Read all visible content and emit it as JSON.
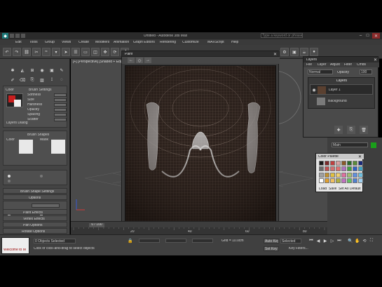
{
  "title_bar": {
    "app_title": "Untitled - Autodesk 3ds Max",
    "search_placeholder": "Type a keyword or phrase"
  },
  "menu": [
    "Edit",
    "Tools",
    "Group",
    "Views",
    "Create",
    "Modifiers",
    "Animation",
    "Graph Editors",
    "Rendering",
    "Customize",
    "MAXScript",
    "Help"
  ],
  "command_panel": {
    "section_color": "Color",
    "section_brush_settings": "Brush Settings",
    "spinners": [
      "Softness",
      "Size",
      "Hardness",
      "Opacity",
      "Spacing",
      "Scatter"
    ],
    "color_label": "Layers Dialog",
    "brush_shapes_title": "Brush Shapes",
    "brush_shape_labels": [
      "Color",
      "Mask"
    ],
    "rollouts": [
      "Brush Shape Settings",
      "Options",
      "Paint Effects",
      "Vertex Effects",
      "Pan Options",
      "Rotate Options"
    ]
  },
  "viewport": {
    "label": "[+] [Perspective] [Shaded + Edged Faces]"
  },
  "render_window": {
    "title": "Paint",
    "tool_labels": [
      "←",
      "◇",
      "→"
    ]
  },
  "layers_dialog": {
    "title": "Layers",
    "menu": [
      "File",
      "Layer",
      "Adjust",
      "Filter",
      "Cmds"
    ],
    "blend_mode": "Normal",
    "opacity_label": "Opacity",
    "opacity_value": "100",
    "list_header": "Layers",
    "layers": [
      "Layer 1",
      "Background"
    ],
    "colors": {
      "panel": "#4a4a4a",
      "selected": "#3b3b3b"
    }
  },
  "color_palette": {
    "title": "Color Palette",
    "swatches": [
      "#1a1a1a",
      "#7a2a2a",
      "#c04040",
      "#d9a0a0",
      "#8a5a2a",
      "#2a6a2a",
      "#5a8a3a",
      "#1a2a7a",
      "#6a6a6a",
      "#c05050",
      "#d07070",
      "#e07070",
      "#b070c0",
      "#40a040",
      "#3060c0",
      "#40a0c0",
      "#a0a0a0",
      "#c09030",
      "#e0c040",
      "#f0d070",
      "#e070a0",
      "#a0c070",
      "#6090e0",
      "#70c0e0",
      "#ffffff",
      "#e0a030",
      "#f0c060",
      "#b0b040",
      "#c070c0",
      "#60c060",
      "#5080d0",
      "#a0d0f0"
    ],
    "buttons": [
      "Load",
      "Save",
      "Set As Default"
    ]
  },
  "right_panel": {
    "name_field": "Main",
    "color_accent": "#1aa01a"
  },
  "timeline": {
    "frame_label": "0 / 100",
    "ticks": [
      "0",
      "10",
      "20",
      "30",
      "40",
      "50",
      "60",
      "70",
      "80",
      "90",
      "100"
    ]
  },
  "status": {
    "selection_text": "0 Objects Selected",
    "prompt_text": "Click or click-and-drag to select objects",
    "grid_label": "Grid = 10.0cm",
    "auto_key_label": "Auto Key",
    "selected_label": "Selected",
    "set_key_label": "Set Key",
    "key_filters_label": "Key Filters...",
    "welcome_text": "Welcome to M"
  }
}
